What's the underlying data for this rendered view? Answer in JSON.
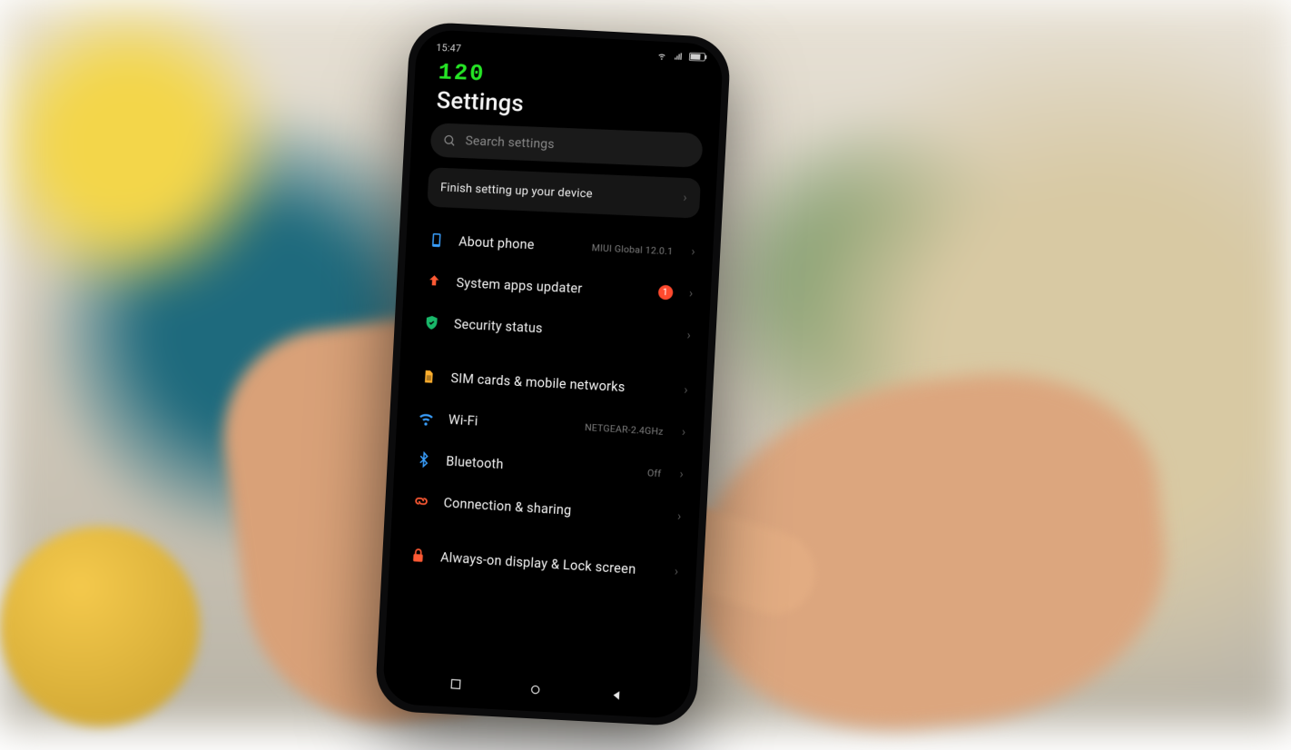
{
  "statusbar": {
    "time": "15:47"
  },
  "overlay": {
    "fps": "120"
  },
  "header": {
    "title": "Settings"
  },
  "search": {
    "placeholder": "Search settings"
  },
  "setup_card": {
    "label": "Finish setting up your device"
  },
  "groups": [
    {
      "rows": [
        {
          "key": "about",
          "label": "About phone",
          "sub": "MIUI Global 12.0.1",
          "icon": "phone",
          "icon_color": "#3aa0ff"
        },
        {
          "key": "updater",
          "label": "System apps updater",
          "badge": "1",
          "icon": "arrow-up",
          "icon_color": "#ff5a34"
        },
        {
          "key": "security",
          "label": "Security status",
          "icon": "shield",
          "icon_color": "#19b86a"
        }
      ]
    },
    {
      "rows": [
        {
          "key": "sim",
          "label": "SIM cards & mobile networks",
          "icon": "sim",
          "icon_color": "#ffb02e"
        },
        {
          "key": "wifi",
          "label": "Wi-Fi",
          "sub": "NETGEAR-2.4GHz",
          "icon": "wifi",
          "icon_color": "#3aa0ff"
        },
        {
          "key": "bt",
          "label": "Bluetooth",
          "sub": "Off",
          "icon": "bt",
          "icon_color": "#3aa0ff"
        },
        {
          "key": "share",
          "label": "Connection & sharing",
          "icon": "link",
          "icon_color": "#ff5a34"
        }
      ]
    },
    {
      "rows": [
        {
          "key": "aod",
          "label": "Always-on display & Lock screen",
          "icon": "lock",
          "icon_color": "#ff5a34"
        }
      ]
    }
  ]
}
